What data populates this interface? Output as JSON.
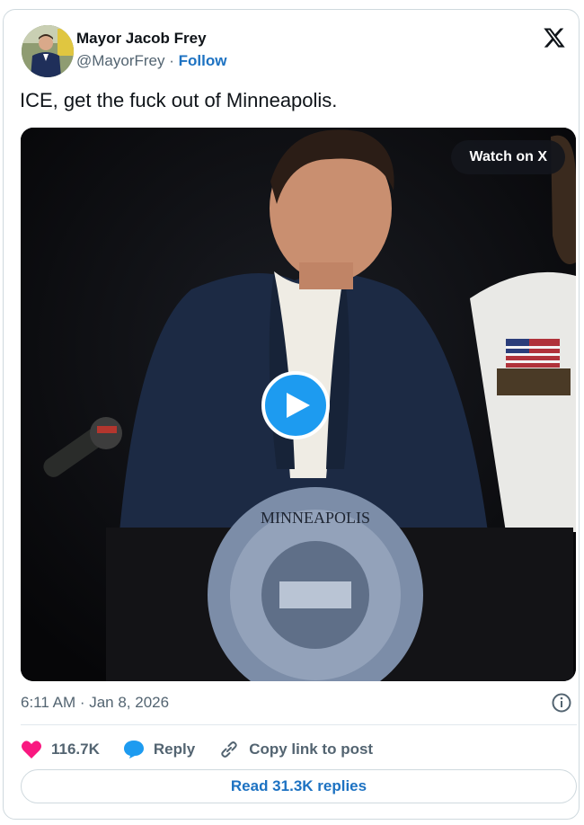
{
  "author": {
    "name": "Mayor Jacob Frey",
    "handle": "@MayorFrey",
    "separator": "·",
    "follow_label": "Follow",
    "avatar_icon": "profile-photo"
  },
  "tweet": {
    "text": "ICE, get the fuck out of Minneapolis.",
    "timestamp": "6:11 AM · Jan 8, 2026"
  },
  "video": {
    "watch_label": "Watch on X",
    "seal_text": "CITY OF MINNEAPOLIS MINN.",
    "play_icon": "play-icon"
  },
  "actions": {
    "likes": "116.7K",
    "reply_label": "Reply",
    "copy_label": "Copy link to post"
  },
  "read_replies_label": "Read 31.3K replies",
  "colors": {
    "accent": "#1d9bf0",
    "link": "#1d72c2",
    "like": "#f91880",
    "muted": "#536471"
  }
}
